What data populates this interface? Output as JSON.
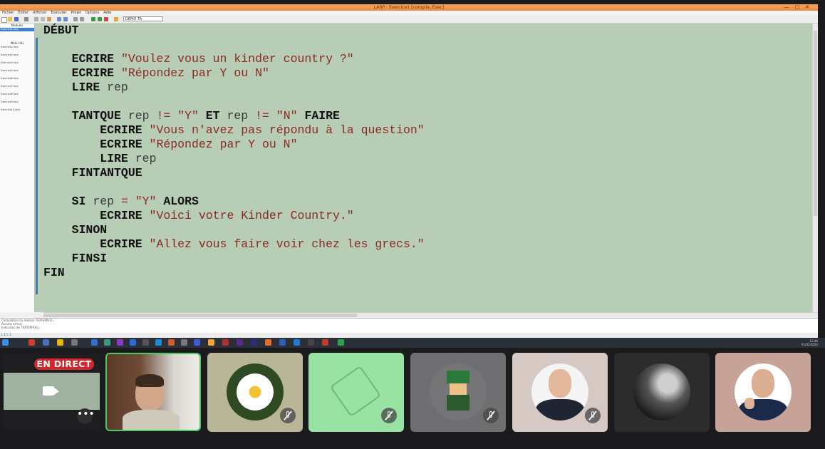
{
  "window": {
    "title": "LARP - Exercice1 [compile, Exec]"
  },
  "menu": [
    "Fichier",
    "Éditer",
    "Afficher",
    "Exécuter",
    "Projet",
    "Options",
    "Aide"
  ],
  "toolbar": {
    "combo_value": "DEMO TA"
  },
  "left_panel": {
    "header1": "Modules",
    "header2": "Mots-clés",
    "items": [
      "Exercice1.larp",
      "Exercice2.larp",
      "Exercice3.larp",
      "Exercice4.larp",
      "Exercice5.larp",
      "Exercice6.larp",
      "Exercice7.larp",
      "Exercice8.larp",
      "Exercice9.larp",
      "Exercice10.larp"
    ]
  },
  "code": {
    "lines": [
      [
        {
          "t": "DÉBUT",
          "k": "kw"
        }
      ],
      [],
      [
        {
          "t": "    "
        },
        {
          "t": "ECRIRE",
          "k": "kw"
        },
        {
          "t": " "
        },
        {
          "t": "\"Voulez vous un kinder country ?\"",
          "k": "str"
        }
      ],
      [
        {
          "t": "    "
        },
        {
          "t": "ECRIRE",
          "k": "kw"
        },
        {
          "t": " "
        },
        {
          "t": "\"Répondez par Y ou N\"",
          "k": "str"
        }
      ],
      [
        {
          "t": "    "
        },
        {
          "t": "LIRE",
          "k": "kw"
        },
        {
          "t": " rep"
        }
      ],
      [],
      [
        {
          "t": "    "
        },
        {
          "t": "TANTQUE",
          "k": "kw"
        },
        {
          "t": " rep "
        },
        {
          "t": "!=",
          "k": "op"
        },
        {
          "t": " "
        },
        {
          "t": "\"Y\"",
          "k": "str"
        },
        {
          "t": " "
        },
        {
          "t": "ET",
          "k": "kw"
        },
        {
          "t": " rep "
        },
        {
          "t": "!=",
          "k": "op"
        },
        {
          "t": " "
        },
        {
          "t": "\"N\"",
          "k": "str"
        },
        {
          "t": " "
        },
        {
          "t": "FAIRE",
          "k": "kw"
        }
      ],
      [
        {
          "t": "        "
        },
        {
          "t": "ECRIRE",
          "k": "kw"
        },
        {
          "t": " "
        },
        {
          "t": "\"Vous n'avez pas répondu à la question\"",
          "k": "str"
        }
      ],
      [
        {
          "t": "        "
        },
        {
          "t": "ECRIRE",
          "k": "kw"
        },
        {
          "t": " "
        },
        {
          "t": "\"Répondez par Y ou N\"",
          "k": "str"
        }
      ],
      [
        {
          "t": "        "
        },
        {
          "t": "LIRE",
          "k": "kw"
        },
        {
          "t": " rep"
        }
      ],
      [
        {
          "t": "    "
        },
        {
          "t": "FINTANTQUE",
          "k": "kw"
        }
      ],
      [],
      [
        {
          "t": "    "
        },
        {
          "t": "SI",
          "k": "kw"
        },
        {
          "t": " rep "
        },
        {
          "t": "=",
          "k": "op"
        },
        {
          "t": " "
        },
        {
          "t": "\"Y\"",
          "k": "str"
        },
        {
          "t": " "
        },
        {
          "t": "ALORS",
          "k": "kw"
        }
      ],
      [
        {
          "t": "        "
        },
        {
          "t": "ECRIRE",
          "k": "kw"
        },
        {
          "t": " "
        },
        {
          "t": "\"Voici votre Kinder Country.\"",
          "k": "str"
        }
      ],
      [
        {
          "t": "    "
        },
        {
          "t": "SINON",
          "k": "kw"
        }
      ],
      [
        {
          "t": "        "
        },
        {
          "t": "ECRIRE",
          "k": "kw"
        },
        {
          "t": " "
        },
        {
          "t": "\"Allez vous faire voir chez les grecs.\"",
          "k": "str"
        }
      ],
      [
        {
          "t": "    "
        },
        {
          "t": "FINSI",
          "k": "kw"
        }
      ],
      [
        {
          "t": "FIN",
          "k": "kw"
        }
      ]
    ]
  },
  "output_panel": {
    "lines": [
      "Compilation du module TEXTEPROG...",
      "Aucune erreur.",
      "Exécution de TEXTEPROG..."
    ]
  },
  "status_bar": {
    "text": "L 1 C 1"
  },
  "taskbar": {
    "clock": "11:46",
    "date": "01/02/2022"
  },
  "meeting": {
    "live_badge": "EN DIRECT",
    "more_label": "•••",
    "colors": {
      "live": "#d4272d",
      "active_border": "#4ccb64",
      "editor_bg": "#b8cdb5"
    }
  }
}
